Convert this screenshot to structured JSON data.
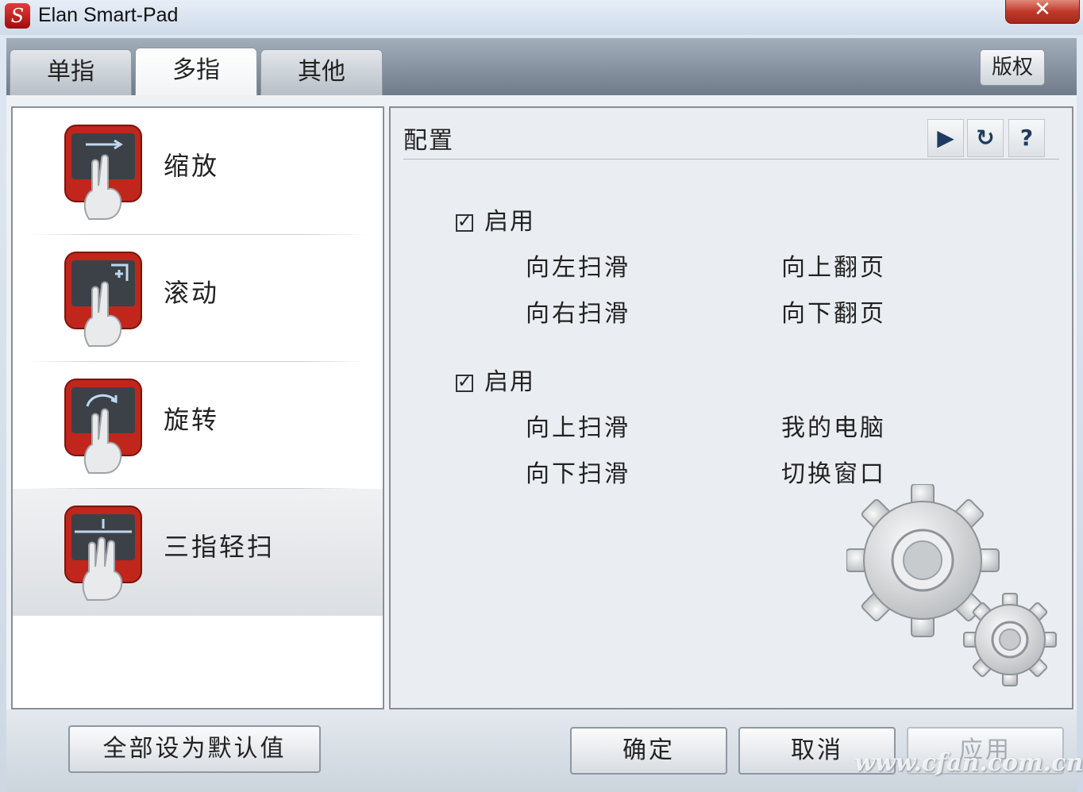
{
  "window": {
    "title": "Elan Smart-Pad",
    "close_glyph": "✕"
  },
  "tabs": [
    {
      "label": "单指",
      "active": false
    },
    {
      "label": "多指",
      "active": true
    },
    {
      "label": "其他",
      "active": false
    }
  ],
  "header": {
    "copyright_label": "版权"
  },
  "gestures": [
    {
      "label": "缩放",
      "icon": "pinch-zoom-icon"
    },
    {
      "label": "滚动",
      "icon": "scroll-icon"
    },
    {
      "label": "旋转",
      "icon": "rotate-icon"
    },
    {
      "label": "三指轻扫",
      "icon": "three-finger-swipe-icon",
      "selected": true
    }
  ],
  "config": {
    "title": "配置",
    "tools": {
      "play": "▶",
      "refresh": "↻",
      "help": "?"
    },
    "groups": [
      {
        "enable_label": "启用",
        "checked": true,
        "rows": [
          [
            "向左扫滑",
            "向上翻页"
          ],
          [
            "向右扫滑",
            "向下翻页"
          ]
        ]
      },
      {
        "enable_label": "启用",
        "checked": true,
        "rows": [
          [
            "向上扫滑",
            "我的电脑"
          ],
          [
            "向下扫滑",
            "切换窗口"
          ]
        ]
      }
    ]
  },
  "footer": {
    "reset_label": "全部设为默认值",
    "ok_label": "确定",
    "cancel_label": "取消",
    "apply_label": "应用",
    "watermark": "www.cfan.com.cn"
  },
  "colors": {
    "accent_red": "#c0392b",
    "panel_border": "#8a8f95"
  }
}
